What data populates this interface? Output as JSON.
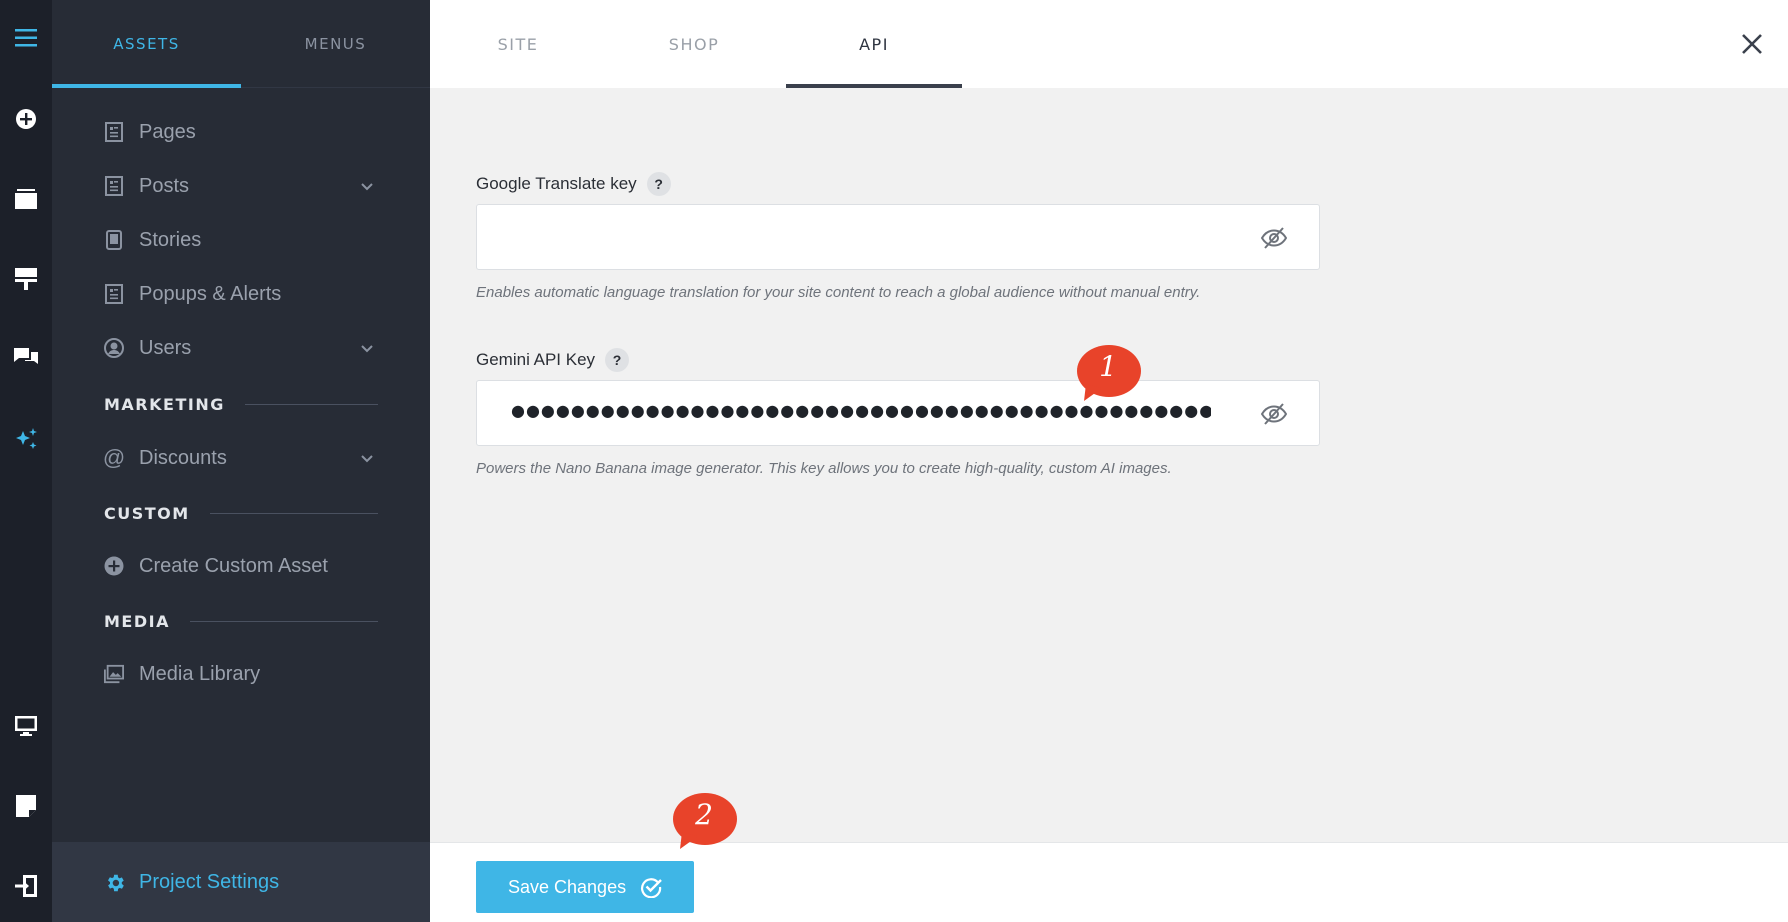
{
  "rail": {
    "icons": [
      "menu-icon",
      "add-circle-icon",
      "layers-icon",
      "brush-icon",
      "chat-icon",
      "sparkles-icon",
      "desktop-icon",
      "page-icon",
      "logout-icon"
    ]
  },
  "sidebar": {
    "tabs": [
      {
        "label": "ASSETS",
        "active": true
      },
      {
        "label": "MENUS",
        "active": false
      }
    ],
    "items": [
      {
        "label": "Pages",
        "icon": "page-icon"
      },
      {
        "label": "Posts",
        "icon": "page-icon",
        "expandable": true
      },
      {
        "label": "Stories",
        "icon": "mobile-icon"
      },
      {
        "label": "Popups & Alerts",
        "icon": "page-icon"
      },
      {
        "label": "Users",
        "icon": "user-circle-icon",
        "expandable": true
      }
    ],
    "sections": {
      "marketing": {
        "label": "MARKETING",
        "items": [
          {
            "label": "Discounts",
            "icon": "at-icon",
            "expandable": true
          }
        ]
      },
      "custom": {
        "label": "CUSTOM",
        "items": [
          {
            "label": "Create Custom Asset",
            "icon": "add-circle-icon"
          }
        ]
      },
      "media": {
        "label": "MEDIA",
        "items": [
          {
            "label": "Media Library",
            "icon": "images-icon"
          }
        ]
      }
    },
    "footer": {
      "label": "Project Settings",
      "icon": "gear-icon"
    }
  },
  "header": {
    "tabs": [
      {
        "label": "SITE",
        "active": false
      },
      {
        "label": "SHOP",
        "active": false
      },
      {
        "label": "API",
        "active": true
      }
    ]
  },
  "form": {
    "google_translate": {
      "label": "Google Translate key",
      "help_badge": "?",
      "value": "",
      "help": "Enables automatic language translation for your site content to reach a global audience without manual entry."
    },
    "gemini": {
      "label": "Gemini API Key",
      "help_badge": "?",
      "value": "●●●●●●●●●●●●●●●●●●●●●●●●●●●●●●●●●●●●●●●●●●●●●●●●●●●●●",
      "help": "Powers the Nano Banana image generator. This key allows you to create high-quality, custom AI images."
    }
  },
  "callouts": [
    "1",
    "2"
  ],
  "footer": {
    "save_label": "Save Changes"
  },
  "colors": {
    "accent": "#3fb6e6",
    "callout": "#e8432a",
    "rail_bg": "#1c2029",
    "sidebar_bg": "#272c36"
  }
}
